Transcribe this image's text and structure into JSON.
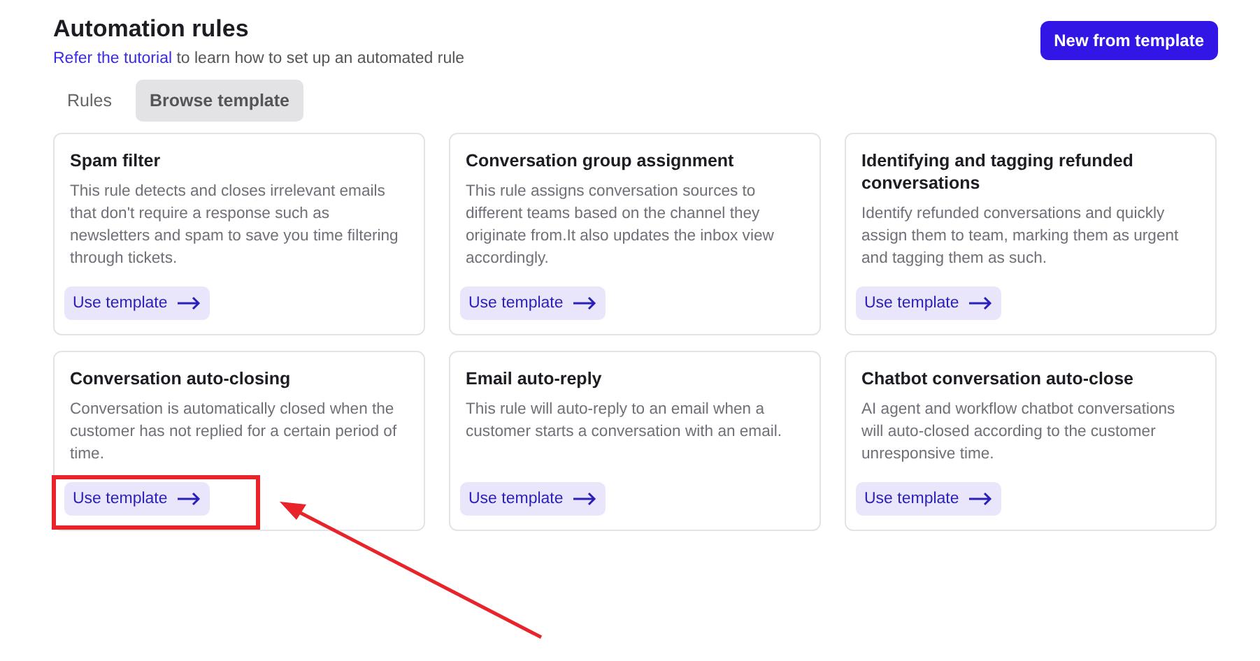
{
  "header": {
    "title": "Automation rules",
    "subtitle_link": "Refer the tutorial",
    "subtitle_rest": " to learn how to set up an automated rule",
    "new_button": "New from template"
  },
  "tabs": [
    {
      "label": "Rules",
      "selected": false
    },
    {
      "label": "Browse template",
      "selected": true
    }
  ],
  "cards": [
    {
      "title": "Spam filter",
      "description": "This rule detects and closes irrelevant emails that don't require a response such as newsletters and spam to save you time filtering through tickets.",
      "button": "Use template",
      "highlighted": false
    },
    {
      "title": "Conversation group assignment",
      "description": "This rule assigns conversation sources to different teams based on the channel they originate from.It also updates the inbox view accordingly.",
      "button": "Use template",
      "highlighted": false
    },
    {
      "title": "Identifying and tagging refunded conversations",
      "description": "Identify refunded conversations and quickly assign them to team, marking them as urgent and tagging them as such.",
      "button": "Use template",
      "highlighted": false
    },
    {
      "title": "Conversation auto-closing",
      "description": "Conversation is automatically closed when the customer has not replied for a certain period of time.",
      "button": "Use template",
      "highlighted": true
    },
    {
      "title": "Email auto-reply",
      "description": "This rule will auto-reply to an email when a customer starts a conversation with an email.",
      "button": "Use template",
      "highlighted": false
    },
    {
      "title": "Chatbot conversation auto-close",
      "description": "AI agent and workflow chatbot conversations will auto-closed according to the customer unresponsive time.",
      "button": "Use template",
      "highlighted": false
    }
  ]
}
